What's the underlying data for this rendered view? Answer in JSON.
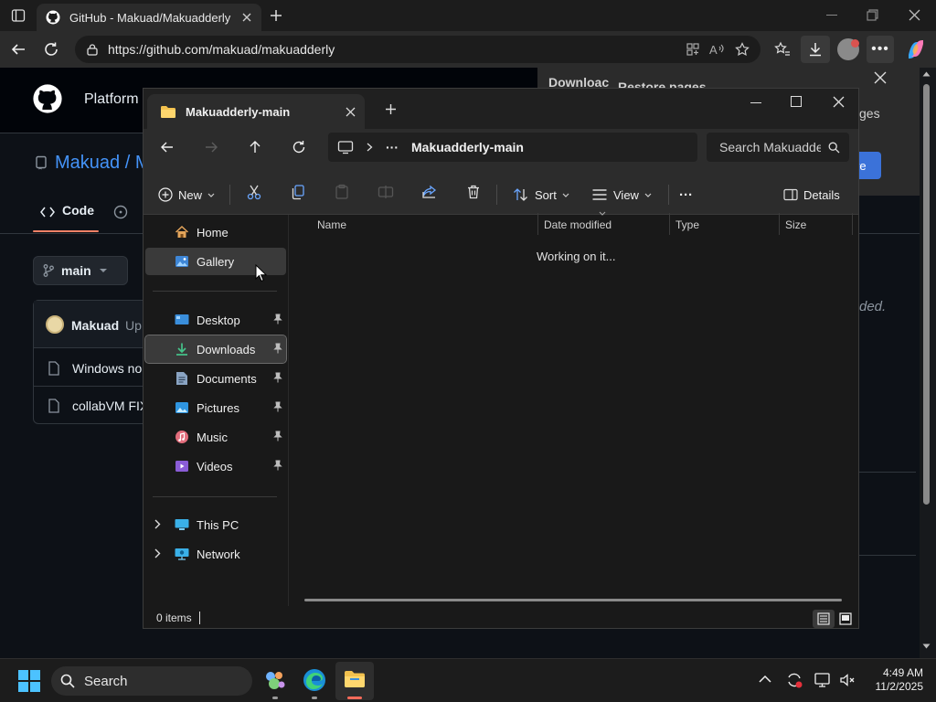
{
  "browser": {
    "tab_title": "GitHub - Makuad/Makuadderly",
    "url": "https://github.com/makuad/makuadderly"
  },
  "github": {
    "platform_label": "Platform",
    "repo_label": "Makuad / M",
    "code_tab": "Code",
    "branch": "main",
    "commit_author": "Makuad",
    "commit_text": "Up",
    "files": [
      "Windows no",
      "collabVM FIX"
    ],
    "right_text": "ded."
  },
  "downloads_panel": {
    "title": "Downloac",
    "restore_title": "Restore pages",
    "restore_text": "ges",
    "restore_button": "re"
  },
  "explorer": {
    "tab_title": "Makuadderly-main",
    "breadcrumb_more": "···",
    "breadcrumb_folder": "Makuadderly-main",
    "search_placeholder": "Search Makuadderly-main",
    "commands": {
      "new": "New",
      "sort": "Sort",
      "view": "View",
      "more": "···",
      "details": "Details"
    },
    "nav": {
      "home": "Home",
      "gallery": "Gallery",
      "desktop": "Desktop",
      "downloads": "Downloads",
      "documents": "Documents",
      "pictures": "Pictures",
      "music": "Music",
      "videos": "Videos",
      "this_pc": "This PC",
      "network": "Network"
    },
    "columns": [
      "Name",
      "Date modified",
      "Type",
      "Size"
    ],
    "working_text": "Working on it...",
    "status_items": "0 items"
  },
  "taskbar": {
    "search_label": "Search",
    "time": "4:49 AM",
    "date": "11/2/2025"
  },
  "colors": {
    "folder_yellow": "#f2c14e",
    "selected_nav": "#3a3a3a",
    "github_link": "#4493f8",
    "accent_blue": "#3b72d9"
  }
}
